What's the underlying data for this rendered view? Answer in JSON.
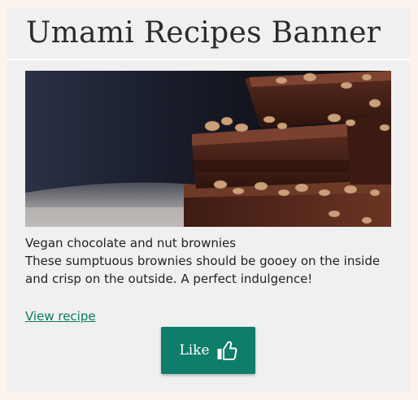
{
  "banner": {
    "title": "Umami Recipes Banner"
  },
  "recipe": {
    "image_alt": "Stacked chocolate brownies with nuts",
    "name": "Vegan chocolate and nut brownies",
    "description": "These sumptuous brownies should be gooey on the inside and crisp on the outside. A perfect indulgence!",
    "link_label": "View recipe"
  },
  "like_button": {
    "label": "Like",
    "icon": "thumbs-up-icon"
  },
  "colors": {
    "accent": "#0e7e6a",
    "link": "#0b7a63",
    "card_background": "#f0f0f0",
    "page_background": "#fbf4ec"
  }
}
